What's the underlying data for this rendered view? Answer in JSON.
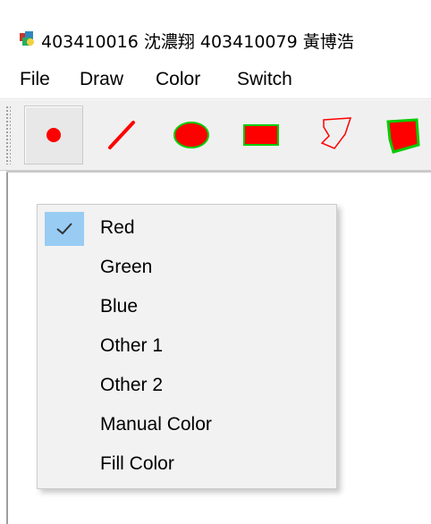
{
  "window": {
    "title": "403410016 沈濃翔 403410079 黃博浩"
  },
  "menubar": {
    "items": [
      "File",
      "Draw",
      "Color",
      "Switch"
    ]
  },
  "toolbar": {
    "tools": [
      {
        "name": "point",
        "icon": "dot-icon",
        "selected": true
      },
      {
        "name": "line",
        "icon": "line-icon"
      },
      {
        "name": "ellipse",
        "icon": "ellipse-icon"
      },
      {
        "name": "rectangle",
        "icon": "rectangle-icon"
      },
      {
        "name": "polygon",
        "icon": "polygon-outline-icon"
      },
      {
        "name": "filled-polygon",
        "icon": "polygon-filled-icon"
      }
    ],
    "colors": {
      "stroke": "#ff0000",
      "fill_border": "#00cc00"
    }
  },
  "color_menu": {
    "items": [
      {
        "label": "Red",
        "checked": true
      },
      {
        "label": "Green"
      },
      {
        "label": "Blue"
      },
      {
        "label": "Other 1"
      },
      {
        "label": "Other 2"
      },
      {
        "label": "Manual Color"
      },
      {
        "label": "Fill Color"
      }
    ],
    "highlight_color": "#99ccf3"
  }
}
